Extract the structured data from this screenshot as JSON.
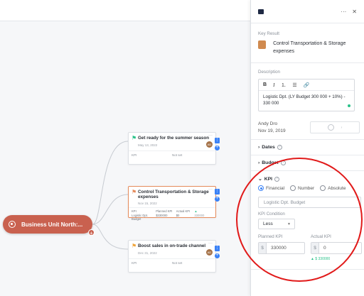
{
  "canvas": {
    "root_node": {
      "label": "Business Unit North:..."
    },
    "cards": [
      {
        "title": "Get ready for the summer season",
        "date": "May 13, 2022",
        "avatar": "AD",
        "kpi_label": "KPI",
        "kpi_value": "Not set"
      },
      {
        "title": "Control Transportation & Storage expenses",
        "date": "Nov 15, 2022",
        "kpi_headers": [
          "KPI",
          "Planned KPI",
          "Actual KPI",
          "▲"
        ],
        "kpi_name": "Logistic Dpt. Budget",
        "kpi_planned": "$330000",
        "kpi_actual": "$0",
        "kpi_delta": "330000"
      },
      {
        "title": "Boost sales in on-trade channel",
        "date": "Dec 31, 2022",
        "avatar": "AD",
        "kpi_label": "KPI",
        "kpi_value": "Not set"
      }
    ]
  },
  "panel": {
    "key_result_label": "Key Result",
    "key_result_title": "Control Transportation & Storage expenses",
    "key_result_color": "#d08a4f",
    "description_label": "Description",
    "description_text": "Logistic Dpt.  (LY Budget 300 000 + 10%) - 330 000",
    "owner_name": "Andy Dro",
    "owner_date": "Nov 19, 2019",
    "sections": {
      "dates": "Dates",
      "budget": "Budget",
      "kpi": "KPI"
    },
    "kpi_types": [
      "Financial",
      "Number",
      "Absolute"
    ],
    "kpi_type_selected": "Financial",
    "kpi_name_placeholder": "Logistic Dpt. Budget",
    "kpi_condition_label": "KPI Condition",
    "kpi_condition_value": "Less",
    "planned_kpi_label": "Planned KPI",
    "planned_kpi_currency": "$",
    "planned_kpi_value": "330000",
    "actual_kpi_label": "Actual KPI",
    "actual_kpi_currency": "$",
    "actual_kpi_value": "0",
    "actual_delta": "▲ $ 330000"
  },
  "colors": {
    "root": "#c9614f",
    "accent": "#3b82f6",
    "highlight": "#e11a1a"
  }
}
